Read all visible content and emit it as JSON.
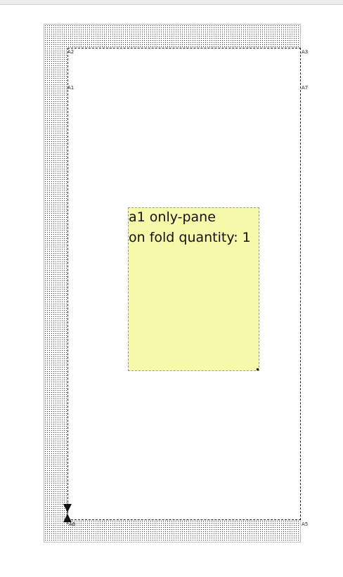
{
  "sheet": {
    "corner_labels": {
      "a1": "A1",
      "a2": "A2",
      "a3": "A3",
      "a5": "A5",
      "a6": "A6",
      "a7": "A7"
    }
  },
  "pane": {
    "title": "a1 only-pane",
    "subtitle": "on fold quantity: 1"
  },
  "colors": {
    "pane_fill": "#f8f8aa",
    "sheet_border": "#222222",
    "outer_pattern": "#333333"
  },
  "icons": {
    "marker": "hinge-arrow-icon",
    "handle": "resize-handle-icon"
  }
}
